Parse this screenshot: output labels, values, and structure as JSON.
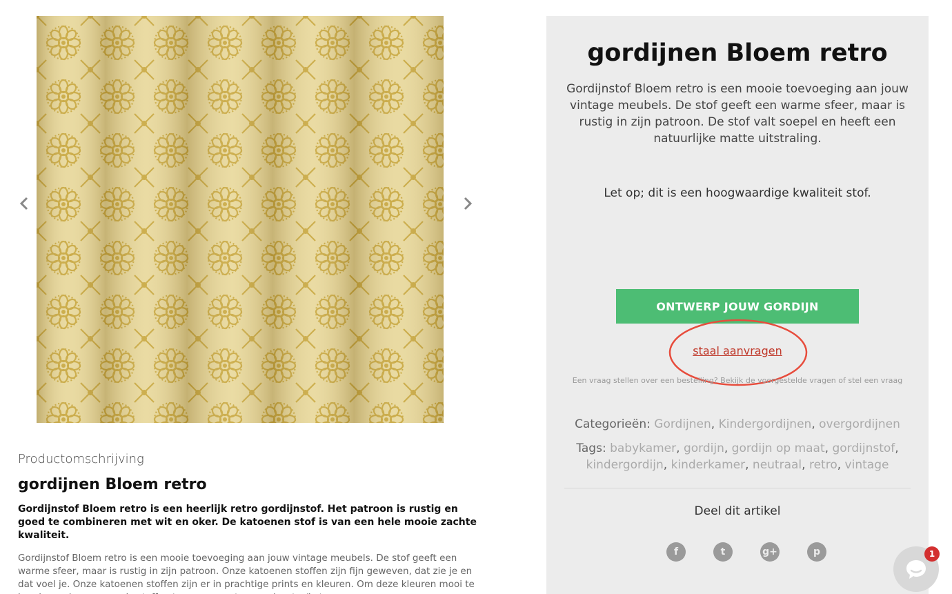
{
  "product": {
    "title": "gordijnen Bloem retro",
    "summary": "Gordijnstof Bloem retro is een mooie toevoeging aan jouw vintage meubels. De stof geeft een warme sfeer, maar is rustig in zijn patroon. De stof valt soepel en heeft een natuurlijke matte uitstraling.",
    "note": "Let op; dit is een hoogwaardige kwaliteit stof.",
    "design_button_label": "ONTWERP JOUW GORDIJN",
    "sample_link_label": "staal aanvragen",
    "help_text": "Een vraag stellen over een bestelling? Bekijk de voorgestelde vragen of stel een vraag",
    "categories_label": "Categorieën:",
    "categories": [
      "Gordijnen",
      "Kindergordijnen",
      "overgordijnen"
    ],
    "tags_label": "Tags:",
    "tags": [
      "babykamer",
      "gordijn",
      "gordijn op maat",
      "gordijnstof",
      "kindergordijn",
      "kinderkamer",
      "neutraal",
      "retro",
      "vintage"
    ],
    "share_label": "Deel dit artikel"
  },
  "gallery": {
    "prev_icon": "chevron-left-icon",
    "next_icon": "chevron-right-icon",
    "image_subject": "mustard floral curtain fabric"
  },
  "description": {
    "label": "Productomschrijving",
    "title": "gordijnen Bloem retro",
    "intro": "Gordijnstof Bloem retro is een heerlijk retro gordijnstof. Het patroon is rustig en goed te combineren met wit en oker. De katoenen stof is van een hele mooie zachte kwaliteit.",
    "body": "Gordijnstof Bloem retro is een mooie toevoeging aan jouw vintage meubels. De stof geeft een warme sfeer, maar is rustig in zijn patroon. Onze katoenen stoffen zijn fijn geweven, dat zie je en dat voel je. Onze katoenen  stoffen zijn er in prachtige prints en kleuren. Om deze kleuren mooi te houden raden we aan de stoffen te voeren met een polyester/katoenen"
  },
  "share": [
    {
      "icon": "facebook-icon",
      "glyph": "f"
    },
    {
      "icon": "twitter-icon",
      "glyph": "t"
    },
    {
      "icon": "google-plus-icon",
      "glyph": "g+"
    },
    {
      "icon": "pinterest-icon",
      "glyph": "p"
    }
  ],
  "chat": {
    "icon": "chat-bubble-icon",
    "badge_count": "1"
  },
  "colors": {
    "panel_bg": "#ececec",
    "button_green": "#4dbd74",
    "annotation_red": "#e74c3c",
    "link_red": "#c0392b",
    "fabric_base": "#d9c170"
  }
}
